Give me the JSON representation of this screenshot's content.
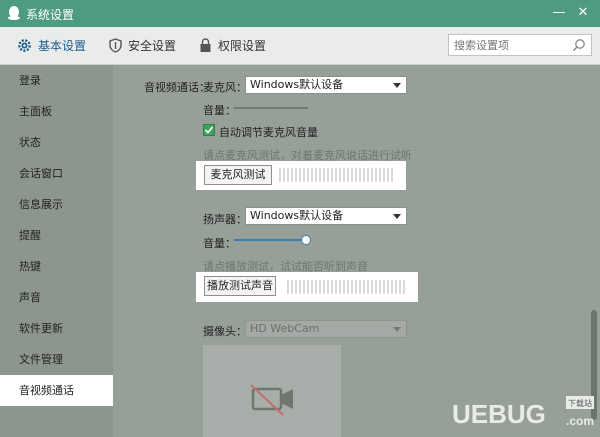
{
  "window": {
    "title": "系统设置",
    "minimize": "—",
    "close": "✕"
  },
  "tabs": [
    {
      "label": "基本设置",
      "icon": "gear-icon"
    },
    {
      "label": "安全设置",
      "icon": "shield-icon"
    },
    {
      "label": "权限设置",
      "icon": "lock-icon"
    }
  ],
  "search": {
    "placeholder": "搜索设置项"
  },
  "sidebar": {
    "items": [
      "登录",
      "主面板",
      "状态",
      "会话窗口",
      "信息展示",
      "提醒",
      "热键",
      "声音",
      "软件更新",
      "文件管理",
      "音视频通话"
    ],
    "active_index": 10
  },
  "content": {
    "section_label": "音视频通话：",
    "mic": {
      "label": "麦克风：",
      "device": "Windows默认设备",
      "volume_label": "音量：",
      "volume_level": 0.0,
      "auto_adjust_label": "自动调节麦克风音量",
      "auto_adjust_checked": true,
      "hint": "请点麦克风测试，对着麦克风说话进行试听",
      "test_button": "麦克风测试"
    },
    "speaker": {
      "label": "扬声器：",
      "device": "Windows默认设备",
      "volume_label": "音量：",
      "volume_level": 1.0,
      "hint": "请点播放测试，试试能否听到声音",
      "test_button": "播放测试声音"
    },
    "camera": {
      "label": "摄像头：",
      "device": "HD WebCam",
      "icon": "camera-off-icon"
    }
  },
  "watermark": {
    "text": "UEBUG",
    "badge": "下载站",
    "domain": ".com"
  },
  "colors": {
    "titlebar": "#4f9a82",
    "accent": "#3a7fb6",
    "check": "#3fa35a"
  }
}
